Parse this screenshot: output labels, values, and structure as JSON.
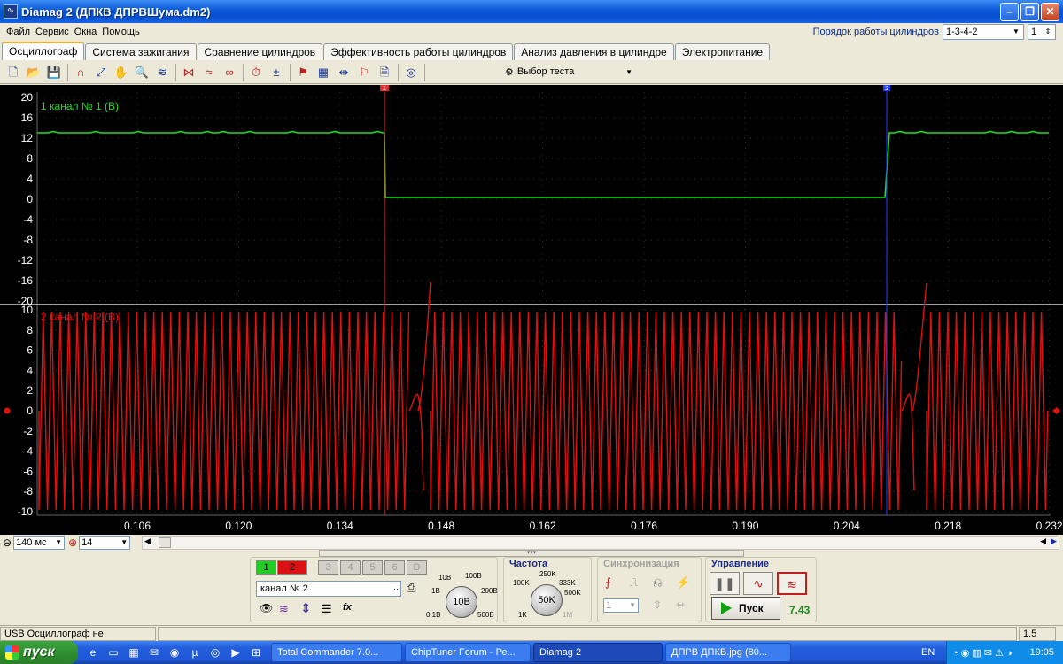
{
  "window": {
    "title": "Diamag 2 (ДПКВ ДПРВШума.dm2)"
  },
  "menu": [
    "Файл",
    "Сервис",
    "Окна",
    "Помощь"
  ],
  "cylinder_order": {
    "label": "Порядок работы цилиндров",
    "value": "1-3-4-2",
    "spinner": "1"
  },
  "tabs": [
    "Осциллограф",
    "Система зажигания",
    "Сравнение цилиндров",
    "Эффективность работы цилиндров",
    "Анализ давления в цилиндре",
    "Электропитание"
  ],
  "test_select": "Выбор теста",
  "scope": {
    "ch1_label": "1  канал № 1 (В)",
    "ch2_label": "2  канал № 2 (В)",
    "ch1_ticks": [
      "20",
      "16",
      "12",
      "8",
      "4",
      "0",
      "-4",
      "-8",
      "-12",
      "-16",
      "-20"
    ],
    "ch2_ticks": [
      "10",
      "8",
      "6",
      "4",
      "2",
      "0",
      "-2",
      "-4",
      "-6",
      "-8",
      "-10"
    ],
    "x_ticks": [
      "0.106",
      "0.120",
      "0.134",
      "0.148",
      "0.162",
      "0.176",
      "0.190",
      "0.204",
      "0.218",
      "0.232"
    ],
    "cursor1_label": "1",
    "cursor2_label": "2",
    "colors": {
      "ch1": "#22dd22",
      "ch2": "#e01010",
      "cursor1": "#e03030",
      "cursor2": "#2040ff"
    }
  },
  "timebase": {
    "value": "140 мс",
    "zoom": "14"
  },
  "control": {
    "channels": [
      "1",
      "2",
      "3",
      "4",
      "5",
      "6",
      "D"
    ],
    "channel_name": "канал № 2",
    "volt_knob": {
      "value": "10В",
      "labels": [
        "10В",
        "100В",
        "1В",
        "200В",
        "0,1В",
        "500В"
      ]
    },
    "freq": {
      "title": "Частота",
      "value": "50K",
      "labels": [
        "250K",
        "100K",
        "333K",
        "500K",
        "1K",
        "1M"
      ]
    },
    "sync_title": "Синхронизация",
    "sync_value": "1",
    "manage_title": "Управление",
    "start_label": "Пуск",
    "rpm": "7.43"
  },
  "status": {
    "usb": "USB Осциллограф не подключен",
    "right": "1.5"
  },
  "taskbar": {
    "start": "пуск",
    "tasks": [
      "Total Commander 7.0...",
      "ChipTuner Forum - Ре...",
      "Diamag 2",
      "ДПРВ ДПКВ.jpg (80..."
    ],
    "lang": "EN",
    "time": "19:05"
  }
}
